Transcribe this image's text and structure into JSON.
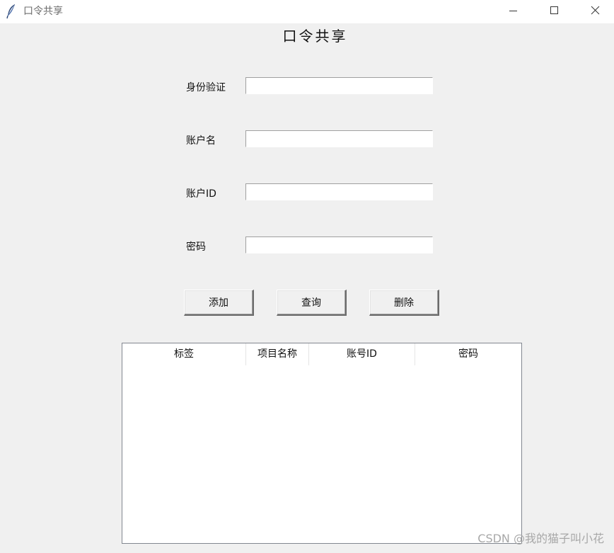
{
  "window": {
    "title": "口令共享",
    "icon": "feather-icon",
    "controls": [
      "minimize-icon",
      "maximize-icon",
      "close-icon"
    ]
  },
  "heading": "口令共享",
  "form": {
    "fields": [
      {
        "label": "身份验证",
        "value": ""
      },
      {
        "label": "账户名",
        "value": ""
      },
      {
        "label": "账户ID",
        "value": ""
      },
      {
        "label": "密码",
        "value": ""
      }
    ]
  },
  "buttons": {
    "add": "添加",
    "query": "查询",
    "delete": "删除"
  },
  "table": {
    "columns": [
      "标签",
      "项目名称",
      "账号ID",
      "密码"
    ],
    "rows": []
  },
  "watermark": "CSDN @我的猫子叫小花"
}
